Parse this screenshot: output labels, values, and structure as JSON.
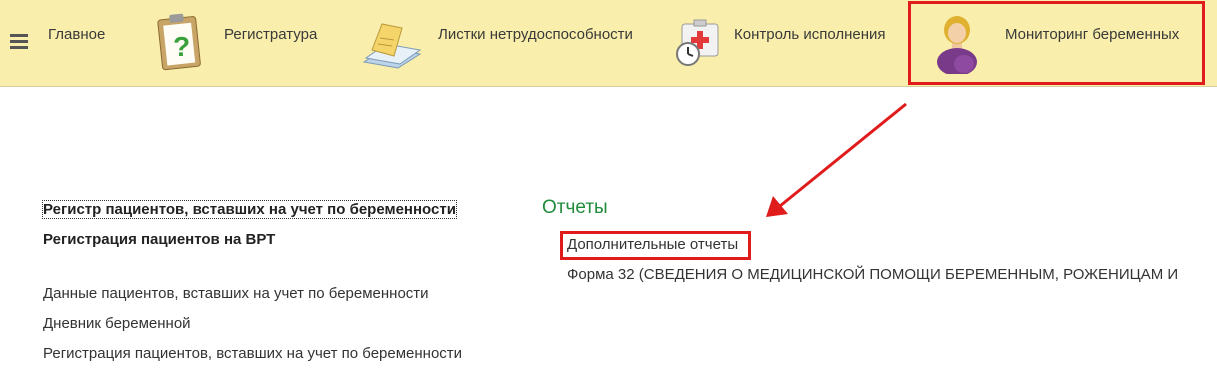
{
  "topbar": {
    "sections": [
      {
        "label": "Главное",
        "icon": "menu-icon"
      },
      {
        "label": "Регистратура",
        "icon": "clipboard-question-icon"
      },
      {
        "label": "Листки нетрудоспособности",
        "icon": "document-stack-icon"
      },
      {
        "label": "Контроль исполнения",
        "icon": "medical-kit-clock-icon"
      },
      {
        "label": "Мониторинг беременных",
        "icon": "pregnant-woman-icon"
      }
    ]
  },
  "left_links": {
    "bold": [
      "Регистр пациентов, вставших на учет по беременности",
      "Регистрация пациентов на ВРТ"
    ],
    "normal": [
      "Данные пациентов, вставших на учет по беременности",
      "Дневник беременной",
      "Регистрация пациентов, вставших на учет по беременности"
    ]
  },
  "reports": {
    "title": "Отчеты",
    "items": [
      "Дополнительные отчеты",
      "Форма 32 (СВЕДЕНИЯ О МЕДИЦИНСКОЙ ПОМОЩИ БЕРЕМЕННЫМ, РОЖЕНИЦАМ И"
    ]
  },
  "annotation_color": "#e01b1b"
}
